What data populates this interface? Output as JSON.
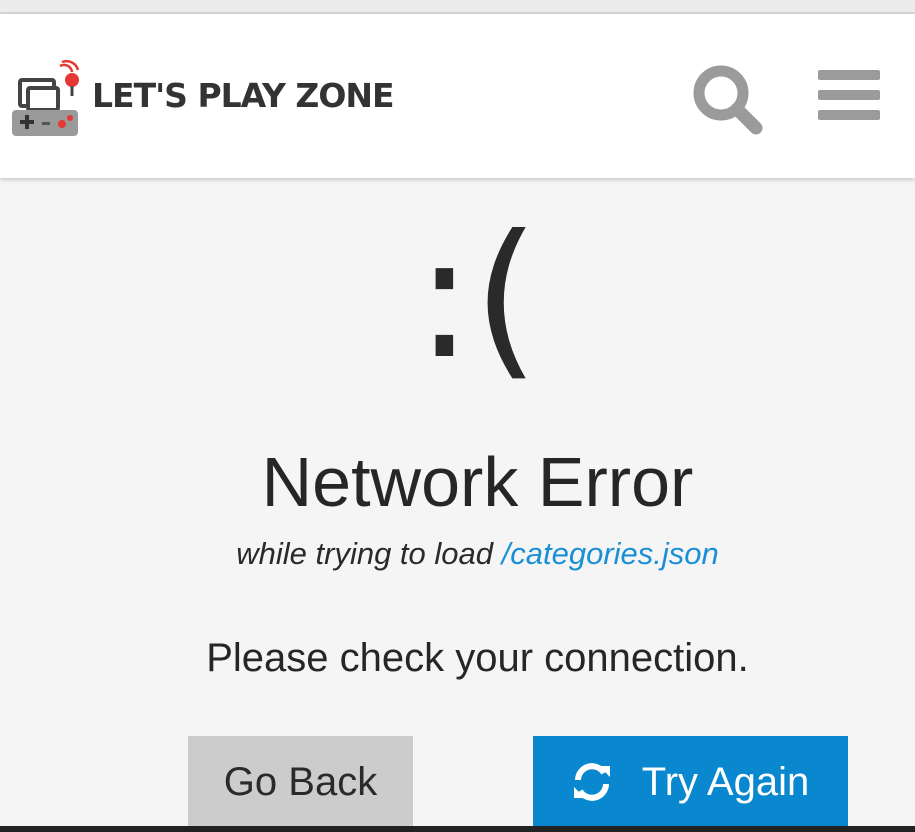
{
  "header": {
    "brand_name": "LET'S PLAY ZONE",
    "logo_icon": "gamepad-joystick-logo",
    "search_icon": "search-icon",
    "menu_icon": "hamburger-menu-icon"
  },
  "error": {
    "face": ":(",
    "title": "Network Error",
    "detail_prefix": "while trying to load",
    "resource": "/categories.json",
    "message": "Please check your connection."
  },
  "actions": {
    "go_back_label": "Go Back",
    "try_again_label": "Try Again",
    "try_again_icon": "refresh-icon"
  },
  "colors": {
    "accent": "#0a88cf",
    "link": "#1a8fd6",
    "secondary_button": "#cccccc",
    "background": "#f5f5f5",
    "icon_gray": "#9b9b9b",
    "logo_red": "#e53935"
  }
}
